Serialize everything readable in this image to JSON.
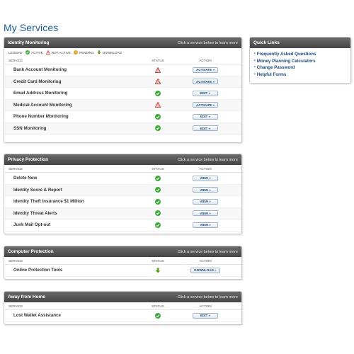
{
  "page": {
    "title": "My Services"
  },
  "legend": {
    "label": "LEGEND:",
    "active": "ACTIVE",
    "not_active": "NOT ACTIVE",
    "pending": "PENDING",
    "download": "DOWNLOAD"
  },
  "columns": {
    "service": "SERVICE",
    "status": "STATUS",
    "action": "ACTION"
  },
  "hint_text": "Click a service below to learn more",
  "sections": {
    "identity": {
      "title": "Identity Monitoring",
      "rows": [
        {
          "name": "Bank Account Monitoring",
          "status": "not-active",
          "action": "ACTIVATE »"
        },
        {
          "name": "Credit Card Monitoring",
          "status": "not-active",
          "action": "ACTIVATE »"
        },
        {
          "name": "Email Address Monitoring",
          "status": "active",
          "action": "EDIT »"
        },
        {
          "name": "Medical Account Monitoring",
          "status": "not-active",
          "action": "ACTIVATE »"
        },
        {
          "name": "Phone Number Monitoring",
          "status": "active",
          "action": "EDIT »"
        },
        {
          "name": "SSN Monitoring",
          "status": "active",
          "action": "EDIT »"
        }
      ]
    },
    "privacy": {
      "title": "Privacy Protection",
      "rows": [
        {
          "name": "Delete Now",
          "status": "active",
          "action": "VIEW »"
        },
        {
          "name": "Identity Score & Report",
          "status": "active",
          "action": "VIEW »"
        },
        {
          "name": "Identity Theft Insurance $1 Million",
          "status": "active",
          "action": "VIEW »"
        },
        {
          "name": "Identity Threat Alerts",
          "status": "active",
          "action": "VIEW »"
        },
        {
          "name": "Junk Mail Opt-out",
          "status": "active",
          "action": "VIEW »"
        }
      ]
    },
    "computer": {
      "title": "Computer Protection",
      "rows": [
        {
          "name": "Online Protection Tools",
          "status": "download",
          "action": "DOWNLOAD »"
        }
      ]
    },
    "away": {
      "title": "Away from Home",
      "rows": [
        {
          "name": "Lost Wallet Assistance",
          "status": "active",
          "action": "EDIT »"
        }
      ]
    }
  },
  "quick_links": {
    "title": "Quick Links",
    "items": [
      "Frequently Asked Questions",
      "Money Planning Calculators",
      "Change Password",
      "Helpful Forms"
    ]
  },
  "colors": {
    "active": "#3aa935",
    "not_active": "#c0392b",
    "pending": "#e2a619",
    "download": "#5c9d1e",
    "title": "#1a5a8c",
    "link": "#1a4a7a"
  },
  "icons": {
    "active": "check-circle-icon",
    "not-active": "warning-triangle-icon",
    "pending": "clock-icon",
    "download": "download-arrow-icon"
  }
}
